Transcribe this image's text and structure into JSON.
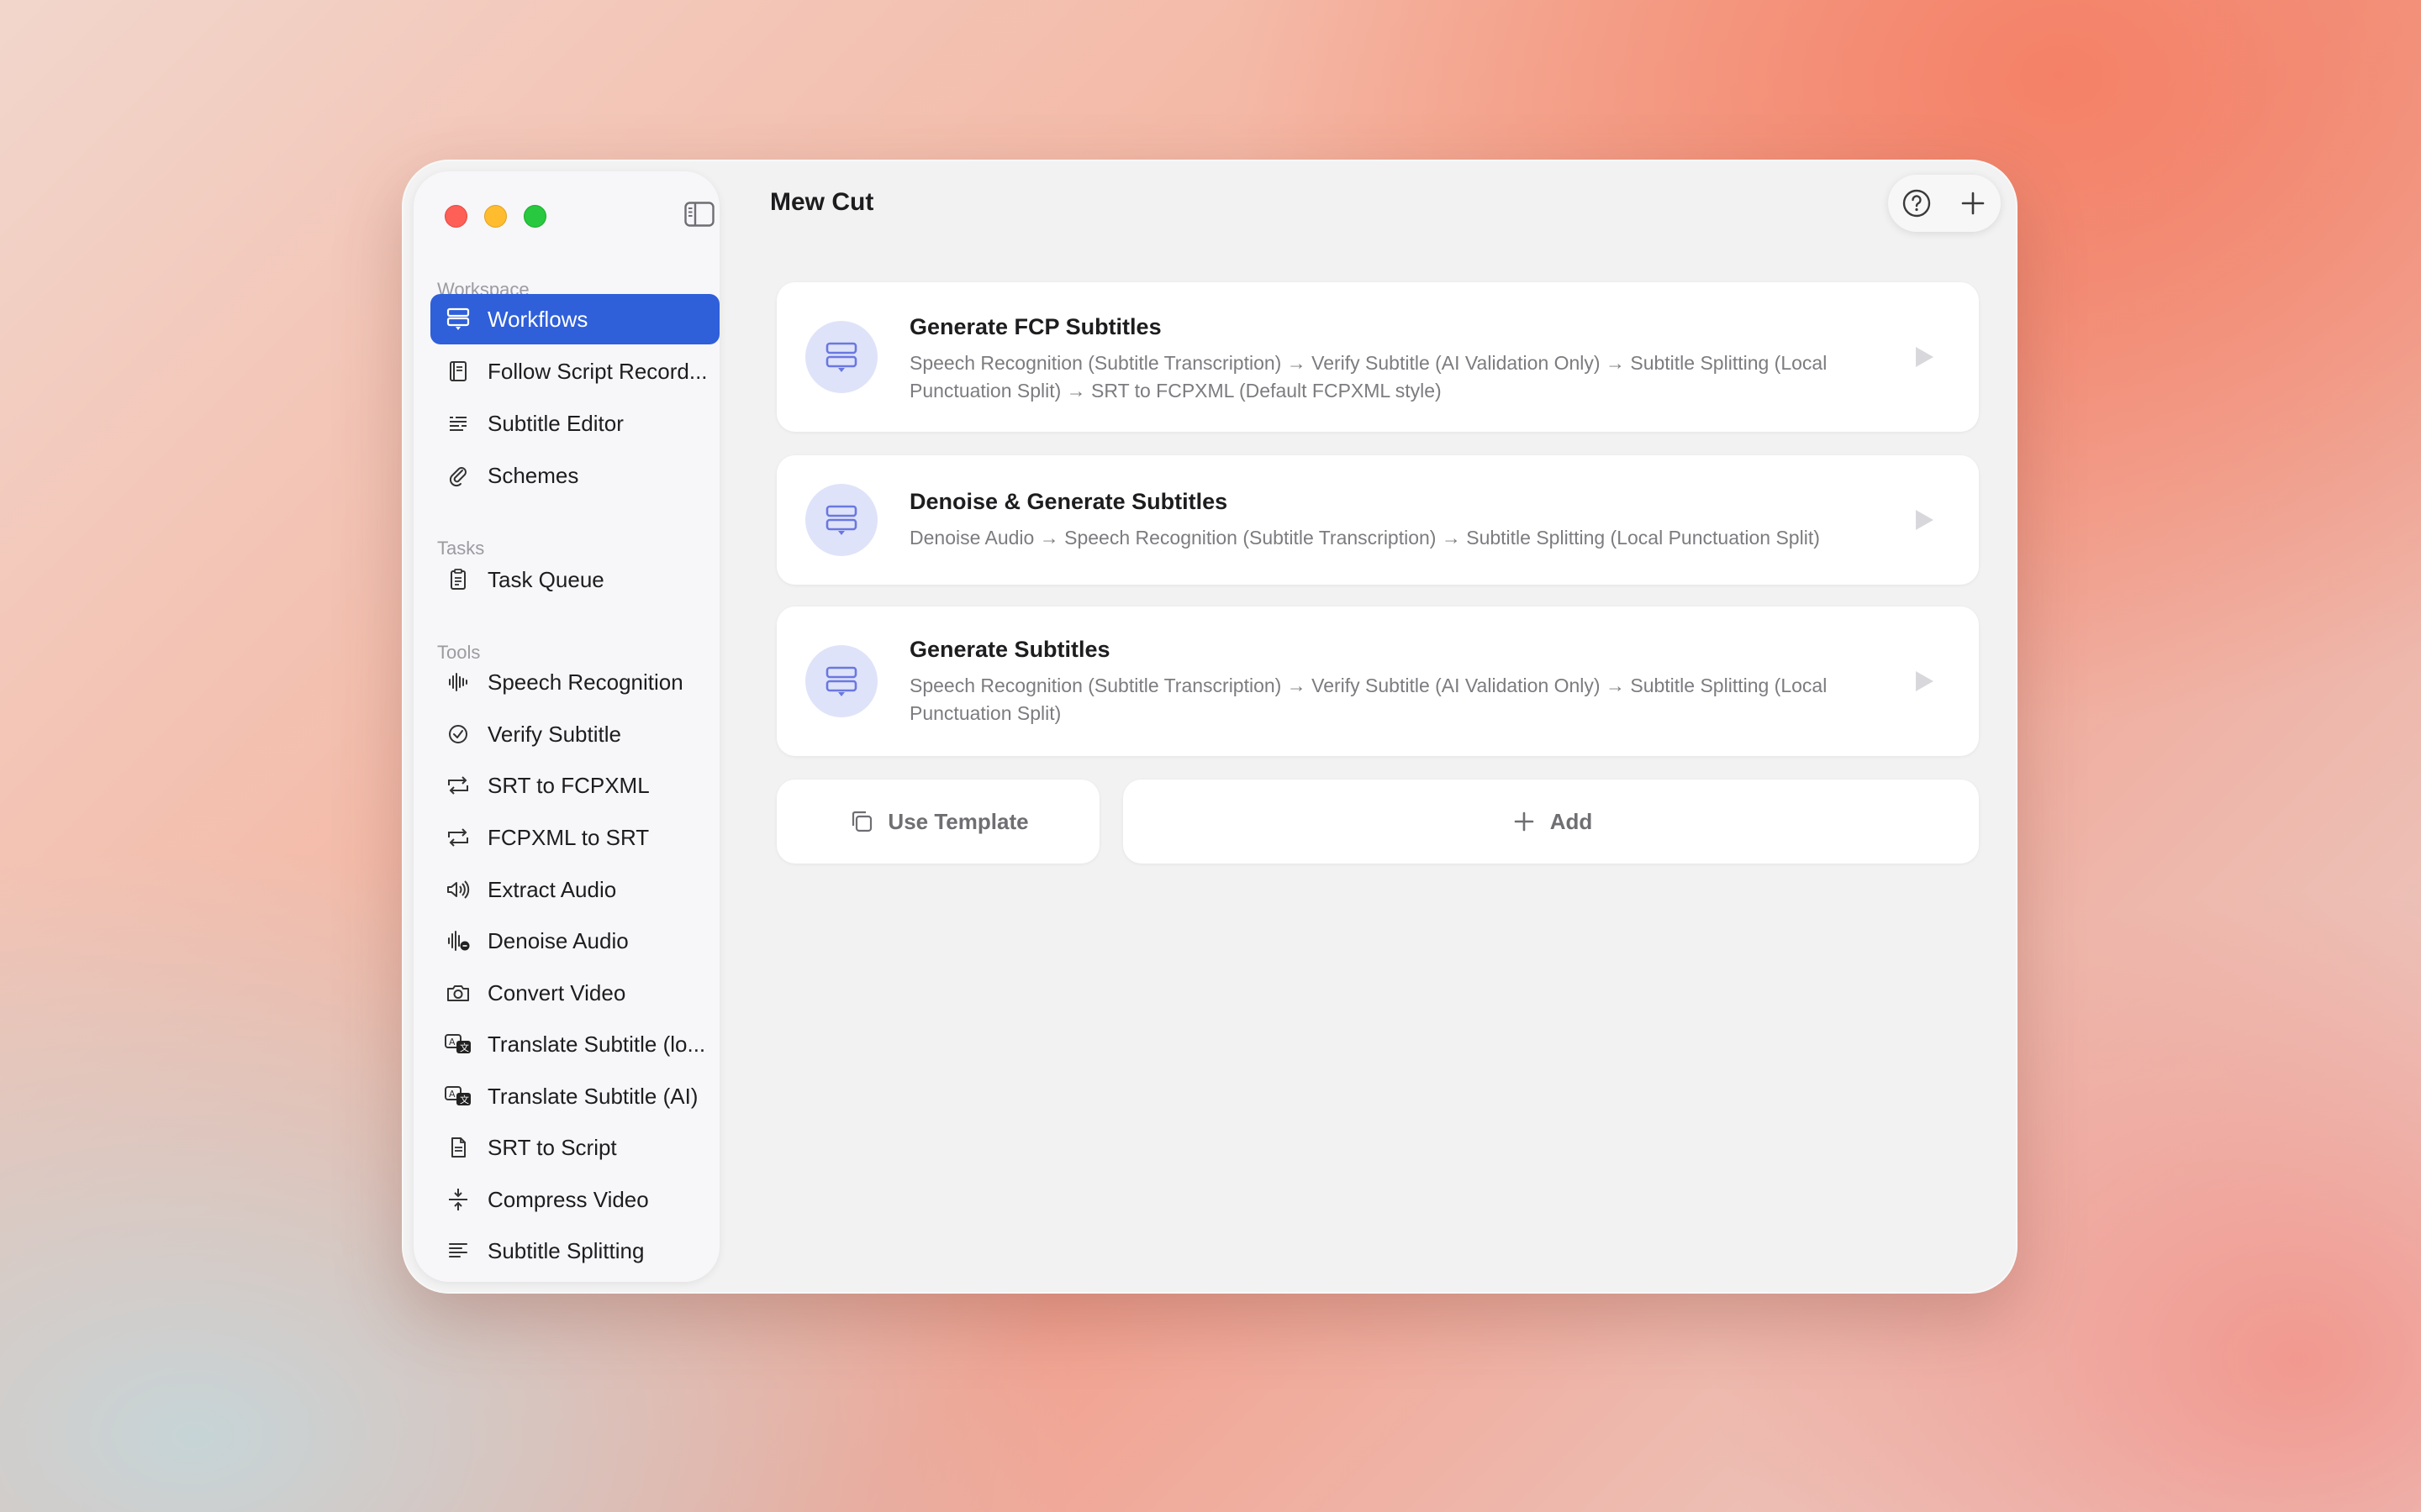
{
  "window": {
    "title": "Mew Cut"
  },
  "sidebar": {
    "sections": {
      "workspace": "Workspace",
      "tasks": "Tasks",
      "tools": "Tools"
    },
    "workspace_items": [
      {
        "label": "Workflows",
        "icon": "workflow-icon",
        "active": true
      },
      {
        "label": "Follow Script Record...",
        "icon": "script-book-icon"
      },
      {
        "label": "Subtitle Editor",
        "icon": "subtitle-lines-icon"
      },
      {
        "label": "Schemes",
        "icon": "paperclip-icon"
      }
    ],
    "task_items": [
      {
        "label": "Task Queue",
        "icon": "clipboard-icon"
      }
    ],
    "tool_items": [
      {
        "label": "Speech Recognition",
        "icon": "waveform-icon"
      },
      {
        "label": "Verify Subtitle",
        "icon": "check-circle-icon"
      },
      {
        "label": "SRT to FCPXML",
        "icon": "convert-arrows-icon"
      },
      {
        "label": "FCPXML to SRT",
        "icon": "convert-arrows-icon"
      },
      {
        "label": "Extract Audio",
        "icon": "speaker-wave-icon"
      },
      {
        "label": "Denoise Audio",
        "icon": "waveform-minus-icon"
      },
      {
        "label": "Convert Video",
        "icon": "camera-rotate-icon"
      },
      {
        "label": "Translate Subtitle (lo...",
        "icon": "translate-icon"
      },
      {
        "label": "Translate Subtitle (AI)",
        "icon": "translate-icon"
      },
      {
        "label": "SRT to Script",
        "icon": "document-icon"
      },
      {
        "label": "Compress Video",
        "icon": "compress-icon"
      },
      {
        "label": "Subtitle Splitting",
        "icon": "text-align-left-icon"
      }
    ]
  },
  "workflows": [
    {
      "title": "Generate FCP Subtitles",
      "description": "Speech Recognition (Subtitle Transcription) → Verify Subtitle (AI Validation Only) → Subtitle Splitting (Local Punctuation Split) → SRT to FCPXML (Default FCPXML style)"
    },
    {
      "title": "Denoise & Generate Subtitles",
      "description": "Denoise Audio → Speech Recognition (Subtitle Transcription) → Subtitle Splitting (Local Punctuation Split)"
    },
    {
      "title": "Generate Subtitles",
      "description": "Speech Recognition (Subtitle Transcription) → Verify Subtitle (AI Validation Only) → Subtitle Splitting (Local Punctuation Split)"
    }
  ],
  "actions": {
    "use_template": "Use Template",
    "add": "Add"
  },
  "colors": {
    "accent": "#2f5fd9",
    "badge_bg": "#dfe3f9",
    "badge_icon": "#6a78e0"
  }
}
